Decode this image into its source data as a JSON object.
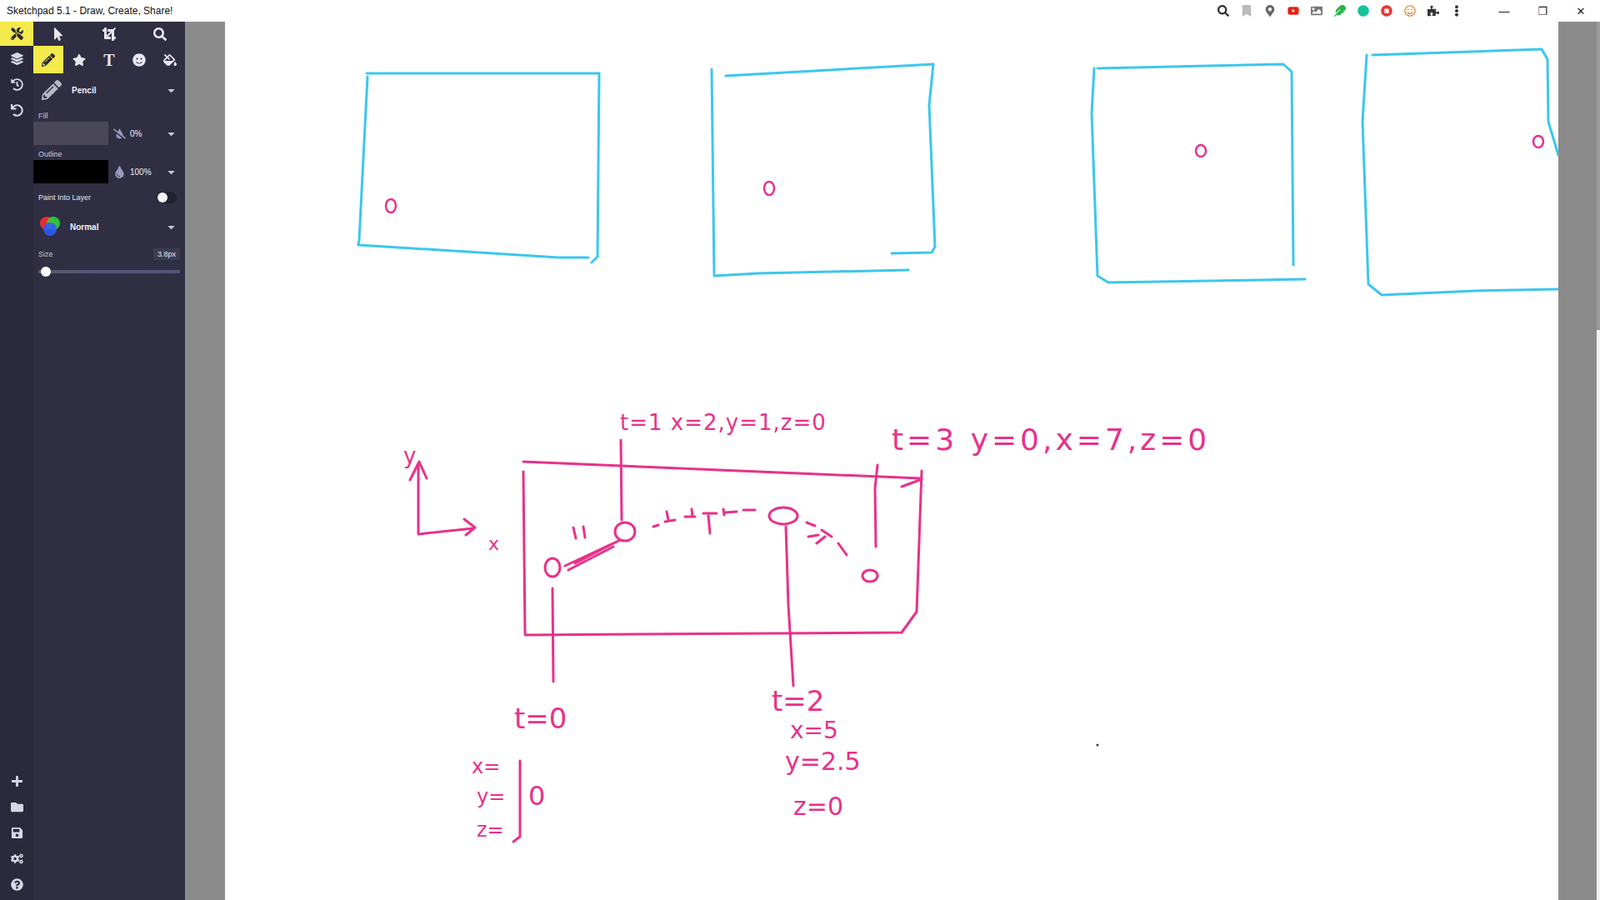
{
  "window": {
    "title": "Sketchpad 5.1 - Draw, Create, Share!",
    "controls": [
      "—",
      "❐",
      "✕"
    ]
  },
  "rail": {
    "top": [
      {
        "kind": "tools",
        "selected": true
      },
      {
        "kind": "layers",
        "selected": false
      },
      {
        "kind": "history",
        "selected": false
      },
      {
        "kind": "undo",
        "selected": false
      }
    ],
    "bottom": [
      {
        "kind": "add"
      },
      {
        "kind": "open"
      },
      {
        "kind": "save"
      },
      {
        "kind": "settings"
      },
      {
        "kind": "help"
      }
    ]
  },
  "tool_rows": [
    [
      {
        "kind": "select",
        "selected": false
      },
      {
        "kind": "crop",
        "selected": false
      },
      {
        "kind": "zoom",
        "selected": false
      }
    ],
    [
      {
        "kind": "pencil",
        "selected": true
      },
      {
        "kind": "shape",
        "selected": false
      },
      {
        "kind": "text",
        "label": "T",
        "selected": false
      },
      {
        "kind": "sticker",
        "selected": false
      },
      {
        "kind": "fill",
        "selected": false
      }
    ]
  ],
  "panel": {
    "brush": "Pencil",
    "fill": {
      "label": "Fill",
      "opacity": "0%"
    },
    "outline": {
      "label": "Outline",
      "opacity": "100%"
    },
    "paint_into_layer": {
      "label": "Paint Into Layer",
      "on": false
    },
    "blend": "Normal",
    "size": {
      "label": "Size",
      "reading": "3.8px",
      "level": 0.04
    }
  },
  "canvas": {
    "labels": [
      "y",
      "x",
      "t=1 x=2,y=1,z=0",
      "t=3 y=0,x=7,z=0",
      "t=0",
      "x=",
      "y=",
      "z=",
      "0",
      "t=2",
      "x=5",
      "y=2.5",
      "z=0"
    ]
  }
}
